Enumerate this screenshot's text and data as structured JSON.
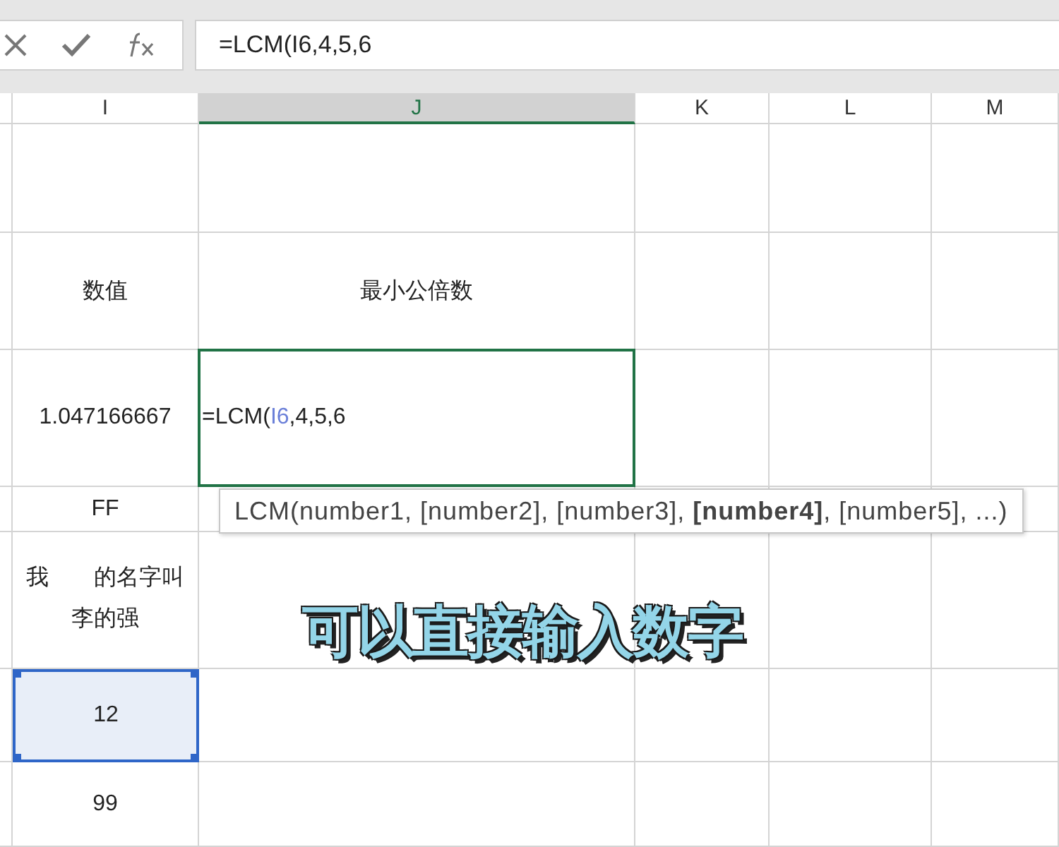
{
  "formula_bar": {
    "buttons": [
      {
        "kind": "cancel"
      },
      {
        "kind": "enter"
      },
      {
        "kind": "function"
      }
    ],
    "formula": "=LCM(I6,4,5,6"
  },
  "columns": [
    {
      "label": "I",
      "selected": false
    },
    {
      "label": "J",
      "selected": true
    },
    {
      "label": "K",
      "selected": false
    },
    {
      "label": "L",
      "selected": false
    },
    {
      "label": "M",
      "selected": false
    }
  ],
  "rows": [
    {
      "cells": [
        {
          "kind": "text",
          "text": "",
          "referenced": false
        },
        {
          "kind": "text",
          "text": ""
        }
      ]
    },
    {
      "cells": [
        {
          "kind": "text",
          "text": "数值",
          "referenced": false
        },
        {
          "kind": "text",
          "text": "最小公倍数"
        }
      ]
    },
    {
      "cells": [
        {
          "kind": "text",
          "text": "1.047166667",
          "referenced": false
        },
        {
          "kind": "editing",
          "parts": [
            {
              "text": "=LCM(",
              "reference": false
            },
            {
              "text": "I6",
              "reference": true
            },
            {
              "text": ",4,5,6",
              "reference": false
            }
          ]
        }
      ]
    },
    {
      "cells": [
        {
          "kind": "text",
          "text": "FF",
          "referenced": false
        },
        {
          "kind": "text",
          "text": ""
        }
      ]
    },
    {
      "cells": [
        {
          "kind": "lines",
          "lines": [
            "我　　的名字叫",
            "李的强"
          ],
          "referenced": false
        },
        {
          "kind": "text",
          "text": ""
        }
      ]
    },
    {
      "cells": [
        {
          "kind": "text",
          "text": "12",
          "referenced": true
        },
        {
          "kind": "text",
          "text": ""
        }
      ]
    },
    {
      "cells": [
        {
          "kind": "text",
          "text": "99",
          "referenced": false
        },
        {
          "kind": "text",
          "text": ""
        }
      ]
    }
  ],
  "tooltip": "LCM(number1, [number2], [number3], **[number4]**, [number5], ...)",
  "caption": "可以直接输入数字"
}
